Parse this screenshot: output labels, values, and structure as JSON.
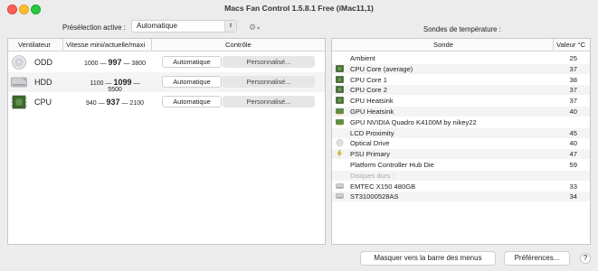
{
  "window": {
    "title": "Macs Fan Control 1.5.8.1 Free (iMac11,1)"
  },
  "preset": {
    "label": "Présélection active :",
    "value": "Automatique"
  },
  "fans": {
    "headers": {
      "fan": "Ventilateur",
      "speed": "Vitesse mini/actuelle/maxi",
      "control": "Contrôle"
    },
    "rows": [
      {
        "name": "ODD",
        "icon": "optical-disc-icon",
        "min": "1000",
        "current": "997",
        "max": "3800",
        "auto": "Automatique",
        "custom": "Personnalisé..."
      },
      {
        "name": "HDD",
        "icon": "hard-drive-icon",
        "min": "1100",
        "current": "1099",
        "max": "5500",
        "auto": "Automatique",
        "custom": "Personnalisé..."
      },
      {
        "name": "CPU",
        "icon": "cpu-chip-icon",
        "min": "940",
        "current": "937",
        "max": "2100",
        "auto": "Automatique",
        "custom": "Personnalisé..."
      }
    ],
    "separator": "—"
  },
  "sensors": {
    "title": "Sondes de température :",
    "headers": {
      "sensor": "Sonde",
      "value": "Valeur °C"
    },
    "rows": [
      {
        "name": "Ambient",
        "value": "25",
        "icon": ""
      },
      {
        "name": "CPU Core (average)",
        "value": "37",
        "icon": "cpu-chip-icon"
      },
      {
        "name": "CPU Core 1",
        "value": "38",
        "icon": "cpu-chip-icon"
      },
      {
        "name": "CPU Core 2",
        "value": "37",
        "icon": "cpu-chip-icon"
      },
      {
        "name": "CPU Heatsink",
        "value": "37",
        "icon": "cpu-chip-icon"
      },
      {
        "name": "GPU Heatsink",
        "value": "40",
        "icon": "gpu-card-icon"
      },
      {
        "name": "GPU NVIDIA Quadro K4100M by nikey22",
        "value": "",
        "icon": "gpu-card-icon"
      },
      {
        "name": "LCD Proximity",
        "value": "45",
        "icon": ""
      },
      {
        "name": "Optical Drive",
        "value": "40",
        "icon": "optical-disc-icon"
      },
      {
        "name": "PSU Primary",
        "value": "47",
        "icon": "power-plug-icon"
      },
      {
        "name": "Platform Controller Hub Die",
        "value": "59",
        "icon": ""
      },
      {
        "name": "Disques durs :",
        "value": "",
        "icon": "",
        "section": true
      },
      {
        "name": "EMTEC X150 480GB",
        "value": "33",
        "icon": "hard-drive-icon"
      },
      {
        "name": "ST31000528AS",
        "value": "34",
        "icon": "hard-drive-icon"
      }
    ]
  },
  "buttons": {
    "menubar": "Masquer vers la barre des menus",
    "prefs": "Préférences...",
    "help": "?"
  },
  "colors": {
    "close": "#ff5f57",
    "minimize": "#febc2e",
    "maximize": "#28c840"
  }
}
